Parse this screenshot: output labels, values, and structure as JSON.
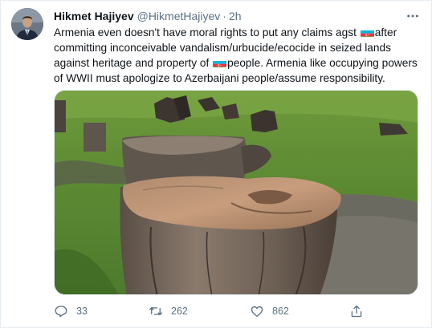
{
  "tweet": {
    "author_name": "Hikmet Hajiyev",
    "author_handle": "@HikmetHajiyev",
    "separator": "·",
    "time": "2h",
    "text_lines": [
      [
        "Armenia even doesn't have moral rights to put any claims agst ",
        "after"
      ],
      [
        "committing inconceivable vandalism/urbucide/ecocide in seized lands"
      ],
      [
        "against heritage and property of ",
        "people. Armenia like occupying powers"
      ],
      [
        "of WWII must apologize to Azerbaijani people/assume responsibility."
      ]
    ],
    "flag_emoji": "azerbaijan-flag-emoji",
    "flag_colors": [
      "#00b5e2",
      "#ef3340",
      "#509e2f"
    ]
  },
  "actions": {
    "reply_count": "33",
    "retweet_count": "262",
    "like_count": "862"
  },
  "icons": {
    "more": "more-icon",
    "reply": "reply-icon",
    "retweet": "retweet-icon",
    "like": "like-icon",
    "share": "share-icon"
  },
  "colors": {
    "text": "#0f1419",
    "secondary": "#5b7083",
    "border": "#e6ecf0"
  }
}
